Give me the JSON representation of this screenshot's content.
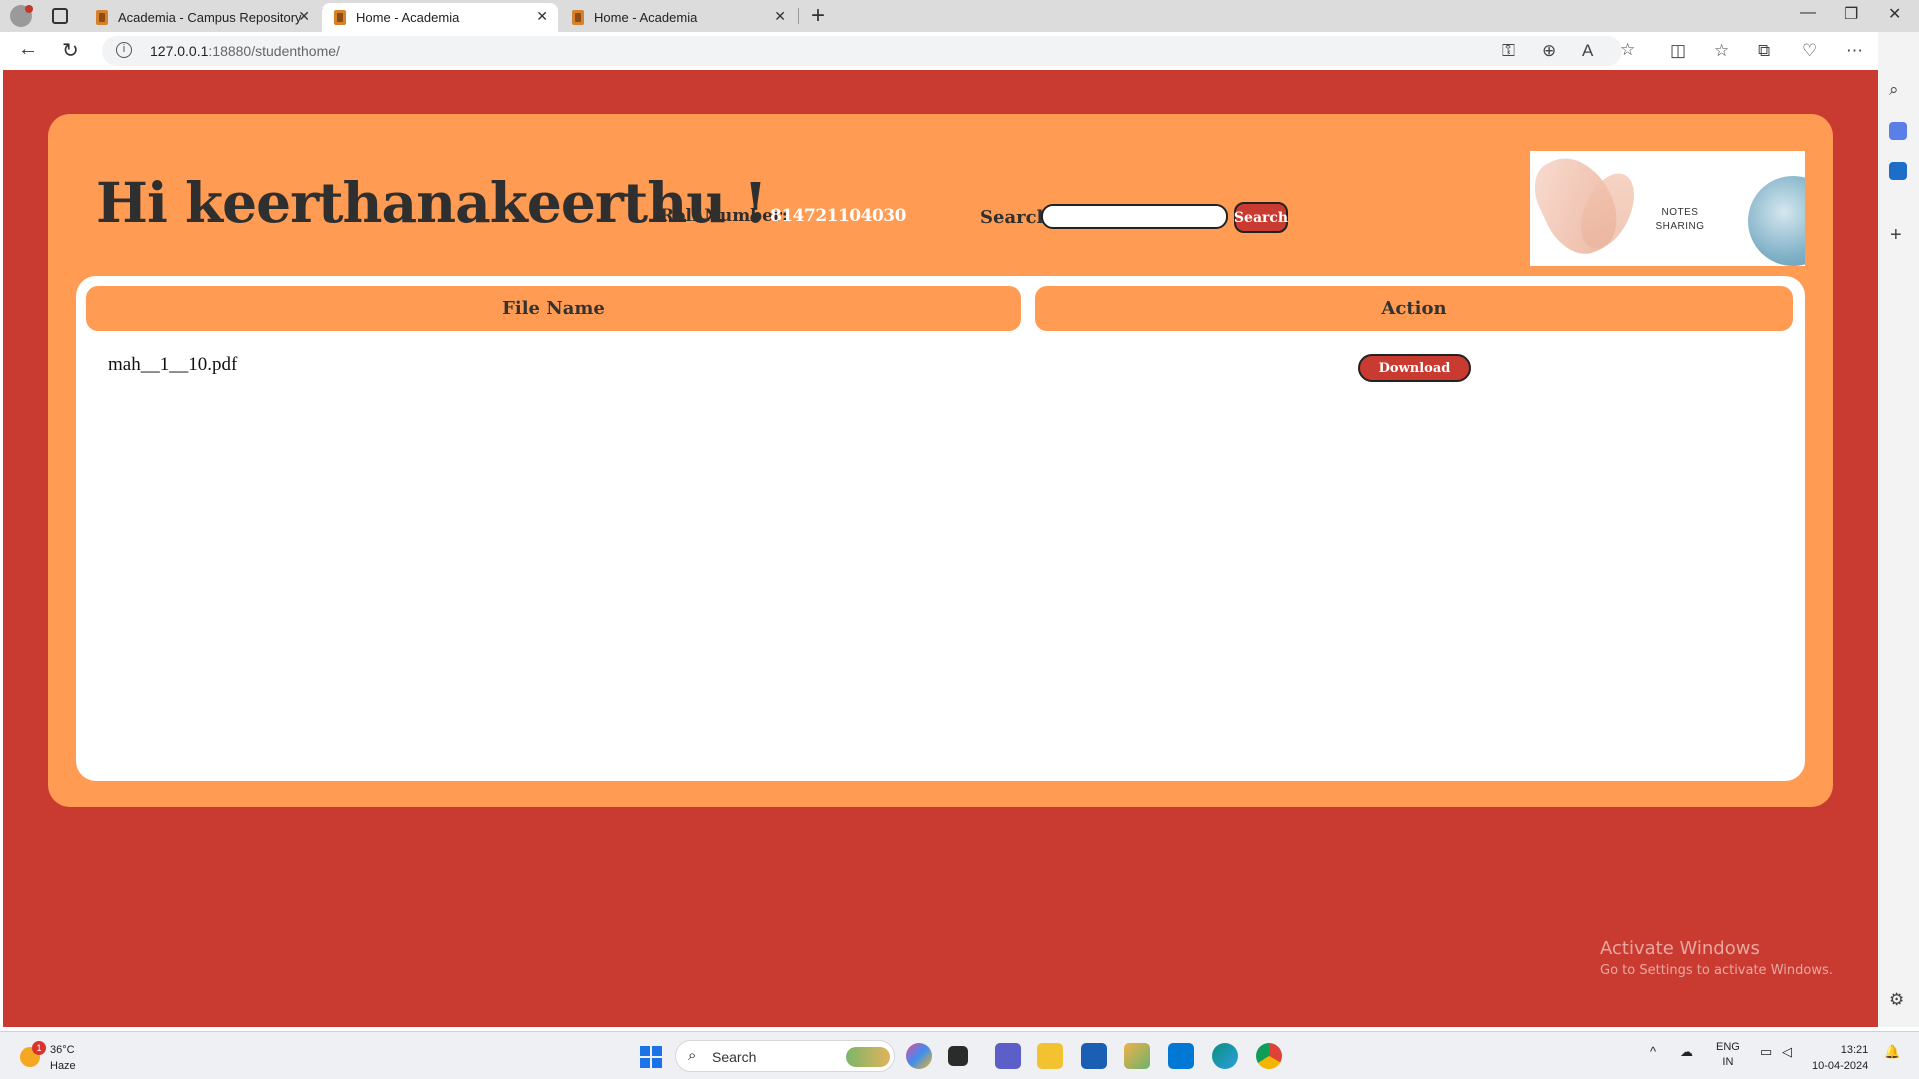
{
  "browser": {
    "tabs": [
      {
        "title": "Academia - Campus Repository",
        "active": false
      },
      {
        "title": "Home - Academia",
        "active": true
      },
      {
        "title": "Home - Academia",
        "active": false
      }
    ],
    "url_host": "127.0.0.1",
    "url_rest": ":18880/studenthome/"
  },
  "page": {
    "greeting": "Hi keerthanakeerthu !",
    "roll_label": "Roll Number:",
    "roll_value": "814721104030",
    "search_label": "Search:",
    "search_value": "",
    "search_button": "Search",
    "banner_text_1": "NOTES",
    "banner_text_2": "SHARING",
    "table": {
      "headers": [
        "File Name",
        "Action"
      ],
      "rows": [
        {
          "file": "mah__1__10.pdf",
          "action": "Download"
        }
      ]
    },
    "colors": {
      "page_bg": "#c93b30",
      "card_bg": "#ff9b52",
      "panel_bg": "#ffffff",
      "button_bg": "#c93b30"
    }
  },
  "watermark": {
    "line1": "Activate Windows",
    "line2": "Go to Settings to activate Windows."
  },
  "taskbar": {
    "weather_temp": "36°C",
    "weather_desc": "Haze",
    "weather_badge": "1",
    "search_placeholder": "Search",
    "lang_1": "ENG",
    "lang_2": "IN",
    "time": "13:21",
    "date": "10-04-2024"
  }
}
